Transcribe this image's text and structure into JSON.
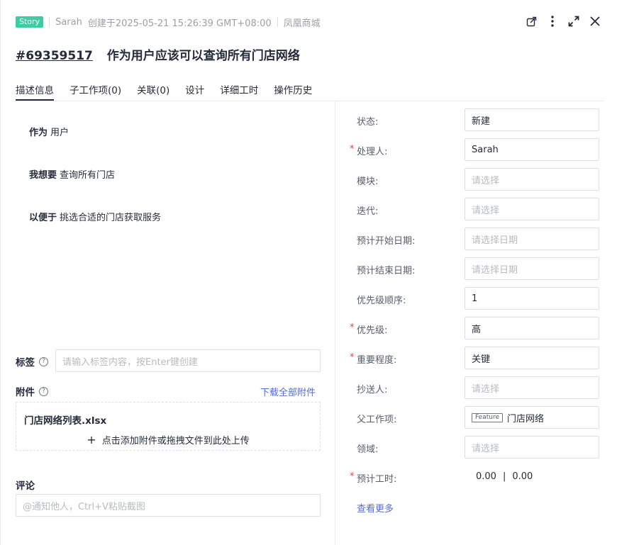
{
  "header": {
    "badge": "Story",
    "author": "Sarah",
    "created": "创建于2025-05-21 15:26:39 GMT+08:00",
    "project": "凤凰商城",
    "id": "#69359517",
    "title": "作为用户应该可以查询所有门店网络"
  },
  "tabs": [
    "描述信息",
    "子工作项(0)",
    "关联(0)",
    "设计",
    "详细工时",
    "操作历史"
  ],
  "description": {
    "as_label": "作为",
    "as_value": "用户",
    "want_label": "我想要",
    "want_value": "查询所有门店",
    "so_label": "以便于",
    "so_value": "挑选合适的门店获取服务"
  },
  "tags": {
    "label": "标签",
    "help": "?",
    "placeholder": "请输入标签内容，按Enter键创建"
  },
  "attachments": {
    "label": "附件",
    "help": "?",
    "download_all": "下载全部附件",
    "file_name": "门店网络列表.xlsx",
    "upload_hint": "点击添加附件或拖拽文件到此处上传",
    "plus": "+"
  },
  "comments": {
    "label": "评论",
    "placeholder": "@通知他人，Ctrl+V粘贴截图"
  },
  "fields": {
    "required_mark": "*",
    "status": {
      "label": "状态:",
      "value": "新建"
    },
    "assignee": {
      "label": "处理人:",
      "value": "Sarah"
    },
    "module": {
      "label": "模块:",
      "placeholder": "请选择"
    },
    "iteration": {
      "label": "迭代:",
      "placeholder": "请选择"
    },
    "start_date": {
      "label": "预计开始日期:",
      "placeholder": "请选择日期"
    },
    "end_date": {
      "label": "预计结束日期:",
      "placeholder": "请选择日期"
    },
    "priority_order": {
      "label": "优先级顺序:",
      "value": "1"
    },
    "priority": {
      "label": "优先级:",
      "value": "高"
    },
    "severity": {
      "label": "重要程度:",
      "value": "关键"
    },
    "cc": {
      "label": "抄送人:",
      "placeholder": "请选择"
    },
    "parent": {
      "label": "父工作项:",
      "tag": "Feature",
      "value": "门店网络"
    },
    "domain": {
      "label": "领域:",
      "placeholder": "请选择"
    },
    "estimated_hours": {
      "label": "预计工时:",
      "value1": "0.00",
      "divider": "|",
      "value2": "0.00"
    }
  },
  "view_more": "查看更多",
  "icons": [
    "external-window-icon",
    "more-vertical-icon",
    "expand-icon",
    "close-icon",
    "help-icon",
    "plus-icon"
  ],
  "colors": {
    "badge": "#3dcca6",
    "link": "#526ecc",
    "required": "#e54545"
  }
}
